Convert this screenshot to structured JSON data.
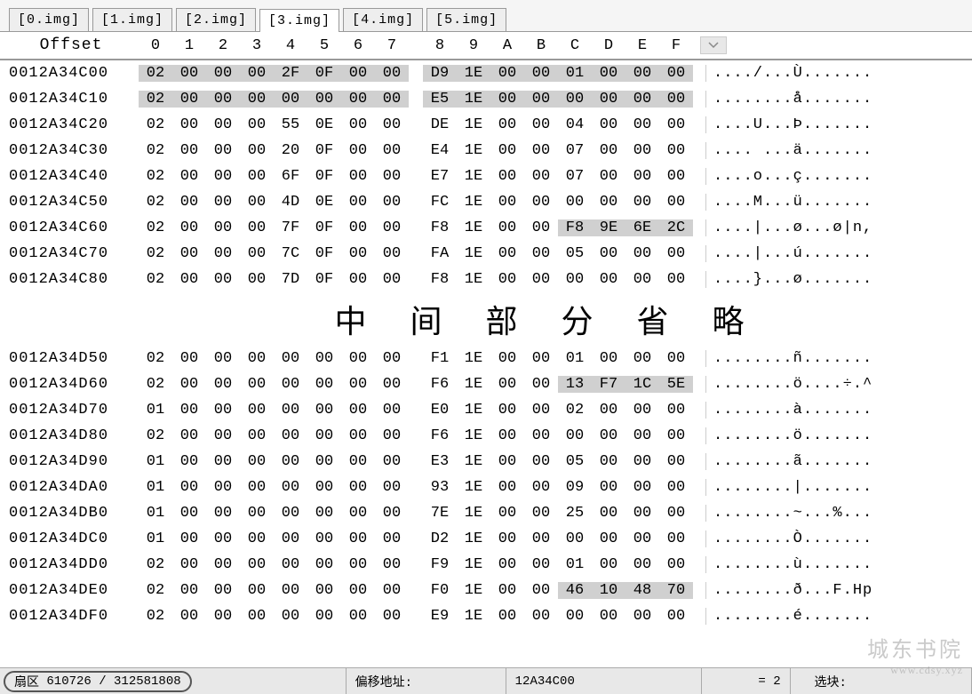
{
  "tabs": [
    {
      "label": "[0.img]",
      "active": false
    },
    {
      "label": "[1.img]",
      "active": false
    },
    {
      "label": "[2.img]",
      "active": false
    },
    {
      "label": "[3.img]",
      "active": true
    },
    {
      "label": "[4.img]",
      "active": false
    },
    {
      "label": "[5.img]",
      "active": false
    }
  ],
  "header": {
    "offset_label": "Offset",
    "columns": [
      "0",
      "1",
      "2",
      "3",
      "4",
      "5",
      "6",
      "7",
      "8",
      "9",
      "A",
      "B",
      "C",
      "D",
      "E",
      "F"
    ]
  },
  "ellipsis_text": "中 间 部 分 省 略",
  "rows_top": [
    {
      "offset": "0012A34C00",
      "hex": [
        "02",
        "00",
        "00",
        "00",
        "2F",
        "0F",
        "00",
        "00",
        "D9",
        "1E",
        "00",
        "00",
        "01",
        "00",
        "00",
        "00"
      ],
      "hl": [
        0,
        1,
        2,
        3,
        4,
        5,
        6,
        7,
        8,
        9,
        10,
        11,
        12,
        13,
        14,
        15
      ],
      "ascii": "..../...Ù......."
    },
    {
      "offset": "0012A34C10",
      "hex": [
        "02",
        "00",
        "00",
        "00",
        "00",
        "00",
        "00",
        "00",
        "E5",
        "1E",
        "00",
        "00",
        "00",
        "00",
        "00",
        "00"
      ],
      "hl": [
        0,
        1,
        2,
        3,
        4,
        5,
        6,
        7,
        8,
        9,
        10,
        11,
        12,
        13,
        14,
        15
      ],
      "ascii": "........å......."
    },
    {
      "offset": "0012A34C20",
      "hex": [
        "02",
        "00",
        "00",
        "00",
        "55",
        "0E",
        "00",
        "00",
        "DE",
        "1E",
        "00",
        "00",
        "04",
        "00",
        "00",
        "00"
      ],
      "hl": [],
      "ascii": "....U...Þ......."
    },
    {
      "offset": "0012A34C30",
      "hex": [
        "02",
        "00",
        "00",
        "00",
        "20",
        "0F",
        "00",
        "00",
        "E4",
        "1E",
        "00",
        "00",
        "07",
        "00",
        "00",
        "00"
      ],
      "hl": [],
      "ascii": ".... ...ä......."
    },
    {
      "offset": "0012A34C40",
      "hex": [
        "02",
        "00",
        "00",
        "00",
        "6F",
        "0F",
        "00",
        "00",
        "E7",
        "1E",
        "00",
        "00",
        "07",
        "00",
        "00",
        "00"
      ],
      "hl": [],
      "ascii": "....o...ç......."
    },
    {
      "offset": "0012A34C50",
      "hex": [
        "02",
        "00",
        "00",
        "00",
        "4D",
        "0E",
        "00",
        "00",
        "FC",
        "1E",
        "00",
        "00",
        "00",
        "00",
        "00",
        "00"
      ],
      "hl": [],
      "ascii": "....M...ü......."
    },
    {
      "offset": "0012A34C60",
      "hex": [
        "02",
        "00",
        "00",
        "00",
        "7F",
        "0F",
        "00",
        "00",
        "F8",
        "1E",
        "00",
        "00",
        "F8",
        "9E",
        "6E",
        "2C"
      ],
      "hl": [
        12,
        13,
        14,
        15
      ],
      "ascii": "....|...ø...ø|n,"
    },
    {
      "offset": "0012A34C70",
      "hex": [
        "02",
        "00",
        "00",
        "00",
        "7C",
        "0F",
        "00",
        "00",
        "FA",
        "1E",
        "00",
        "00",
        "05",
        "00",
        "00",
        "00"
      ],
      "hl": [],
      "ascii": "....|...ú......."
    },
    {
      "offset": "0012A34C80",
      "hex": [
        "02",
        "00",
        "00",
        "00",
        "7D",
        "0F",
        "00",
        "00",
        "F8",
        "1E",
        "00",
        "00",
        "00",
        "00",
        "00",
        "00"
      ],
      "hl": [],
      "ascii": "....}...ø......."
    }
  ],
  "rows_bottom": [
    {
      "offset": "0012A34D50",
      "hex": [
        "02",
        "00",
        "00",
        "00",
        "00",
        "00",
        "00",
        "00",
        "F1",
        "1E",
        "00",
        "00",
        "01",
        "00",
        "00",
        "00"
      ],
      "hl": [],
      "ascii": "........ñ......."
    },
    {
      "offset": "0012A34D60",
      "hex": [
        "02",
        "00",
        "00",
        "00",
        "00",
        "00",
        "00",
        "00",
        "F6",
        "1E",
        "00",
        "00",
        "13",
        "F7",
        "1C",
        "5E"
      ],
      "hl": [
        12,
        13,
        14,
        15
      ],
      "ascii": "........ö....÷.^"
    },
    {
      "offset": "0012A34D70",
      "hex": [
        "01",
        "00",
        "00",
        "00",
        "00",
        "00",
        "00",
        "00",
        "E0",
        "1E",
        "00",
        "00",
        "02",
        "00",
        "00",
        "00"
      ],
      "hl": [],
      "ascii": "........à......."
    },
    {
      "offset": "0012A34D80",
      "hex": [
        "02",
        "00",
        "00",
        "00",
        "00",
        "00",
        "00",
        "00",
        "F6",
        "1E",
        "00",
        "00",
        "00",
        "00",
        "00",
        "00"
      ],
      "hl": [],
      "ascii": "........ö......."
    },
    {
      "offset": "0012A34D90",
      "hex": [
        "01",
        "00",
        "00",
        "00",
        "00",
        "00",
        "00",
        "00",
        "E3",
        "1E",
        "00",
        "00",
        "05",
        "00",
        "00",
        "00"
      ],
      "hl": [],
      "ascii": "........ã......."
    },
    {
      "offset": "0012A34DA0",
      "hex": [
        "01",
        "00",
        "00",
        "00",
        "00",
        "00",
        "00",
        "00",
        "93",
        "1E",
        "00",
        "00",
        "09",
        "00",
        "00",
        "00"
      ],
      "hl": [],
      "ascii": "........|......."
    },
    {
      "offset": "0012A34DB0",
      "hex": [
        "01",
        "00",
        "00",
        "00",
        "00",
        "00",
        "00",
        "00",
        "7E",
        "1E",
        "00",
        "00",
        "25",
        "00",
        "00",
        "00"
      ],
      "hl": [],
      "ascii": "........~...%..."
    },
    {
      "offset": "0012A34DC0",
      "hex": [
        "01",
        "00",
        "00",
        "00",
        "00",
        "00",
        "00",
        "00",
        "D2",
        "1E",
        "00",
        "00",
        "00",
        "00",
        "00",
        "00"
      ],
      "hl": [],
      "ascii": "........Ò......."
    },
    {
      "offset": "0012A34DD0",
      "hex": [
        "02",
        "00",
        "00",
        "00",
        "00",
        "00",
        "00",
        "00",
        "F9",
        "1E",
        "00",
        "00",
        "01",
        "00",
        "00",
        "00"
      ],
      "hl": [],
      "ascii": "........ù......."
    },
    {
      "offset": "0012A34DE0",
      "hex": [
        "02",
        "00",
        "00",
        "00",
        "00",
        "00",
        "00",
        "00",
        "F0",
        "1E",
        "00",
        "00",
        "46",
        "10",
        "48",
        "70"
      ],
      "hl": [
        12,
        13,
        14,
        15
      ],
      "ascii": "........ð...F.Hp"
    },
    {
      "offset": "0012A34DF0",
      "hex": [
        "02",
        "00",
        "00",
        "00",
        "00",
        "00",
        "00",
        "00",
        "E9",
        "1E",
        "00",
        "00",
        "00",
        "00",
        "00",
        "00"
      ],
      "hl": [],
      "ascii": "........é......."
    }
  ],
  "status": {
    "sector_label": "扇区",
    "sector_value": "610726 / 312581808",
    "offset_label": "偏移地址:",
    "offset_value": "12A34C00",
    "equals_value": "= 2",
    "selection_label": "选块:"
  },
  "watermark": {
    "ch": "城东书院",
    "en": "www.cdsy.xyz"
  }
}
